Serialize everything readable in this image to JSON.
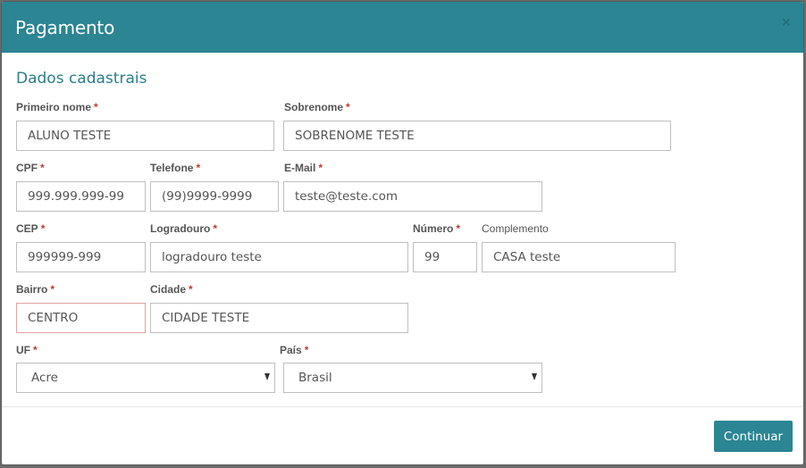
{
  "modal": {
    "title": "Pagamento",
    "close_icon": "×"
  },
  "section": {
    "title": "Dados cadastrais"
  },
  "form": {
    "primeiro_nome": {
      "label": "Primeiro nome",
      "required": "*",
      "value": "ALUNO TESTE"
    },
    "sobrenome": {
      "label": "Sobrenome",
      "required": "*",
      "value": "SOBRENOME TESTE"
    },
    "cpf": {
      "label": "CPF",
      "required": "*",
      "value": "999.999.999-99"
    },
    "telefone": {
      "label": "Telefone",
      "required": "*",
      "value": "(99)9999-9999"
    },
    "email": {
      "label": "E-Mail",
      "required": "*",
      "value": "teste@teste.com"
    },
    "cep": {
      "label": "CEP",
      "required": "*",
      "value": "999999-999"
    },
    "logradouro": {
      "label": "Logradouro",
      "required": "*",
      "value": "logradouro teste"
    },
    "numero": {
      "label": "Número",
      "required": "*",
      "value": "99"
    },
    "complemento": {
      "label": "Complemento",
      "value": "CASA teste"
    },
    "bairro": {
      "label": "Bairro",
      "required": "*",
      "value": "CENTRO"
    },
    "cidade": {
      "label": "Cidade",
      "required": "*",
      "value": "CIDADE TESTE"
    },
    "uf": {
      "label": "UF",
      "required": "*",
      "selected": "Acre"
    },
    "pais": {
      "label": "País",
      "required": "*",
      "selected": "Brasil"
    }
  },
  "footer": {
    "continue_label": "Continuar"
  },
  "colors": {
    "header_bg": "#2b8592",
    "section_title": "#2b7d8a",
    "required_marker": "#c0392b",
    "invalid_border": "#e3a2a2"
  }
}
